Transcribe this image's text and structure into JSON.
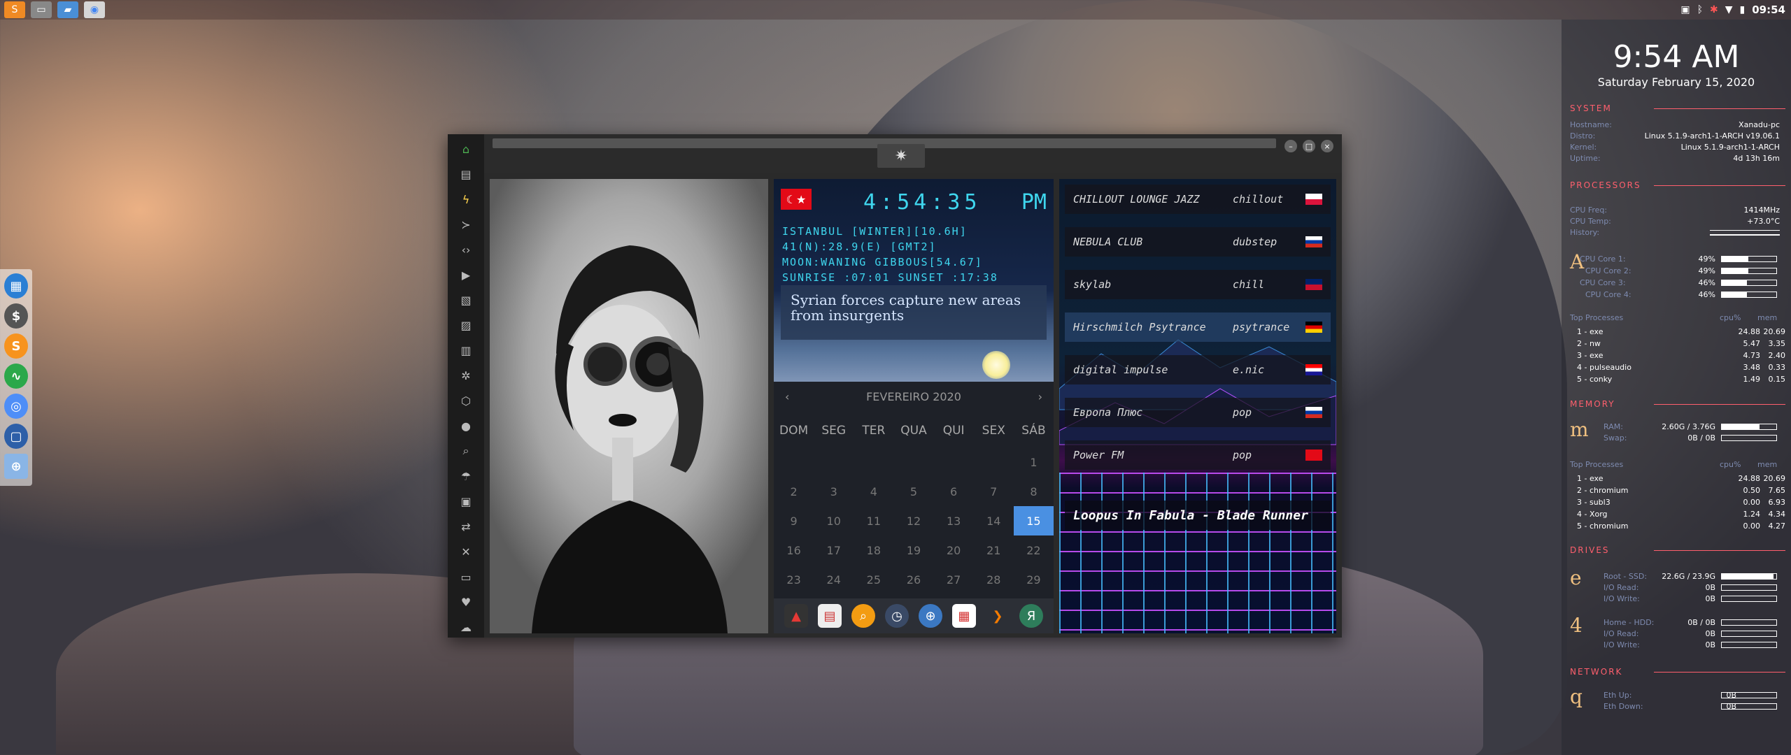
{
  "topbar": {
    "apps": [
      "sublime-text-icon",
      "terminal-icon",
      "files-icon",
      "chrome-icon"
    ],
    "tray_time": "09:54"
  },
  "left_dock": [
    "calendar-icon",
    "money-icon",
    "slack-s-icon",
    "activity-icon",
    "chrome-icon",
    "screenshot-icon",
    "globe-icon"
  ],
  "window": {
    "side_icons": [
      "home-icon",
      "document-icon",
      "bolt-icon",
      "terminal-icon",
      "code-icon",
      "play-icon",
      "pictures-icon",
      "image-icon",
      "news-icon",
      "settings-icon",
      "hexagon-icon",
      "globe-icon",
      "search-icon",
      "umbrella-icon",
      "contact-icon",
      "exchange-icon",
      "fullscreen-icon",
      "youtube-icon",
      "heart-icon",
      "cloud-icon"
    ],
    "title_logo": "rebel-logo-icon"
  },
  "clock_widget": {
    "time": "4:54:35",
    "ampm": "PM",
    "line1": "ISTANBUL [WINTER][10.6H]",
    "line2": "41(N):28.9(E) [GMT2]",
    "line3": "MOON:WANING GIBBOUS[54.67]",
    "line4": "SUNRISE :07:01 SUNSET :17:38",
    "news": "Syrian forces capture new areas from insurgents",
    "flag": "☾★"
  },
  "calendar": {
    "month": "FEVEREIRO 2020",
    "prev": "‹",
    "next": "›",
    "days": [
      "DOM",
      "SEG",
      "TER",
      "QUA",
      "QUI",
      "SEX",
      "SÁB"
    ],
    "cells": [
      "",
      "",
      "",
      "",
      "",
      "",
      "1",
      "2",
      "3",
      "4",
      "5",
      "6",
      "7",
      "8",
      "9",
      "10",
      "11",
      "12",
      "13",
      "14",
      "15",
      "16",
      "17",
      "18",
      "19",
      "20",
      "21",
      "22",
      "23",
      "24",
      "25",
      "26",
      "27",
      "28",
      "29"
    ],
    "today": "15"
  },
  "dock": [
    "pdf-icon",
    "calendar-icon",
    "search-icon",
    "clock-icon",
    "globe-icon",
    "calendar-date-icon",
    "arrow-icon",
    "yandex-icon"
  ],
  "radio": {
    "stations": [
      {
        "name": "CHILLOUT LOUNGE JAZZ",
        "genre": "chillout",
        "flag": "pl"
      },
      {
        "name": "NEBULA CLUB",
        "genre": "dubstep",
        "flag": "ru"
      },
      {
        "name": "skylab",
        "genre": "chill",
        "flag": "gb"
      },
      {
        "name": "Hirschmilch Psytrance",
        "genre": "psytrance",
        "flag": "de"
      },
      {
        "name": "digital impulse",
        "genre": "e.nic",
        "flag": "hr"
      },
      {
        "name": "Европа Плюс",
        "genre": "pop",
        "flag": "ru"
      },
      {
        "name": "Power FM",
        "genre": "pop",
        "flag": "tr"
      }
    ],
    "now_playing": "Loopus In Fabula - Blade Runner",
    "flag_colors": {
      "pl": [
        "#ffffff",
        "#dc143c"
      ],
      "ru": [
        "#ffffff",
        "#0039a6",
        "#d52b1e"
      ],
      "gb": [
        "#012169",
        "#c8102e"
      ],
      "de": [
        "#000000",
        "#dd0000",
        "#ffce00"
      ],
      "hr": [
        "#ff0000",
        "#ffffff",
        "#171796"
      ],
      "tr": [
        "#e30a17",
        "#e30a17"
      ]
    }
  },
  "conky": {
    "time": "9:54 AM",
    "date": "Saturday February 15, 2020",
    "system_title": "SYSTEM",
    "system": [
      {
        "k": "Hostname:",
        "v": "Xanadu-pc"
      },
      {
        "k": "Distro:",
        "v": "Linux 5.1.9-arch1-1-ARCH v19.06.1"
      },
      {
        "k": "Kernel:",
        "v": "Linux 5.1.9-arch1-1-ARCH"
      },
      {
        "k": "Uptime:",
        "v": "4d 13h 16m"
      }
    ],
    "processors_title": "PROCESSORS",
    "cpu_freq": {
      "k": "CPU Freq:",
      "v": "1414MHz"
    },
    "cpu_temp": {
      "k": "CPU Temp:",
      "v": "+73.0°C"
    },
    "history": {
      "k": "History:",
      "v": ""
    },
    "cores": [
      {
        "k": "CPU Core 1:",
        "v": "49%",
        "p": 0.49
      },
      {
        "k": "CPU Core 2:",
        "v": "49%",
        "p": 0.49
      },
      {
        "k": "CPU Core 3:",
        "v": "46%",
        "p": 0.46
      },
      {
        "k": "CPU Core 4:",
        "v": "46%",
        "p": 0.46
      }
    ],
    "top_header": {
      "a": "Top Processes",
      "b": "cpu%",
      "c": "mem"
    },
    "top_cpu": [
      {
        "n": "1 - exe",
        "c": "24.88",
        "m": "20.69"
      },
      {
        "n": "2 - nw",
        "c": "5.47",
        "m": "3.35"
      },
      {
        "n": "3 - exe",
        "c": "4.73",
        "m": "2.40"
      },
      {
        "n": "4 - pulseaudio",
        "c": "3.48",
        "m": "0.33"
      },
      {
        "n": "5 - conky",
        "c": "1.49",
        "m": "0.15"
      }
    ],
    "memory_title": "MEMORY",
    "ram": {
      "k": "RAM:",
      "v": "2.60G / 3.76G",
      "p": 0.69
    },
    "swap": {
      "k": "Swap:",
      "v": "0B / 0B",
      "p": 0
    },
    "top_mem": [
      {
        "n": "1 - exe",
        "c": "24.88",
        "m": "20.69"
      },
      {
        "n": "2 - chromium",
        "c": "0.50",
        "m": "7.65"
      },
      {
        "n": "3 - subl3",
        "c": "0.00",
        "m": "6.93"
      },
      {
        "n": "4 - Xorg",
        "c": "1.24",
        "m": "4.34"
      },
      {
        "n": "5 - chromium",
        "c": "0.00",
        "m": "4.27"
      }
    ],
    "drives_title": "DRIVES",
    "root": {
      "k": "Root - SSD:",
      "v": "22.6G / 23.9G",
      "p": 0.95
    },
    "root_read": {
      "k": "I/O Read:",
      "v": "0B"
    },
    "root_write": {
      "k": "I/O Write:",
      "v": "0B"
    },
    "home": {
      "k": "Home - HDD:",
      "v": "0B / 0B",
      "p": 0
    },
    "home_read": {
      "k": "I/O Read:",
      "v": "0B"
    },
    "home_write": {
      "k": "I/O Write:",
      "v": "0B"
    },
    "network_title": "NETWORK",
    "eth_up": {
      "k": "Eth Up:",
      "v": "0B"
    },
    "eth_down": {
      "k": "Eth Down:",
      "v": "0B"
    },
    "icons": {
      "cpu": "A",
      "mem": "m",
      "drive1": "e",
      "drive2": "4",
      "net": "q"
    }
  }
}
